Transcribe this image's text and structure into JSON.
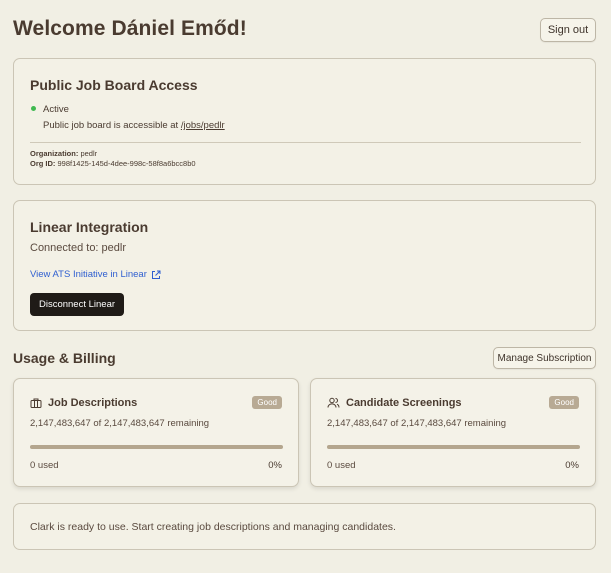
{
  "header": {
    "welcome": "Welcome Dániel Emőd!",
    "sign_out": "Sign out"
  },
  "public_board": {
    "title": "Public Job Board Access",
    "status": "Active",
    "description_prefix": "Public job board is accessible at ",
    "link": "/jobs/pedlr",
    "organization_label": "Organization:",
    "organization_value": "pedlr",
    "org_id_label": "Org ID:",
    "org_id_value": "998f1425-145d-4dee-998c-58f8a6bcc8b0"
  },
  "linear": {
    "title": "Linear Integration",
    "connected": "Connected to: pedlr",
    "link_label": "View ATS Initiative in Linear",
    "disconnect": "Disconnect Linear"
  },
  "billing": {
    "title": "Usage & Billing",
    "manage": "Manage Subscription",
    "job_descriptions": {
      "title": "Job Descriptions",
      "badge": "Good",
      "remaining": "2,147,483,647 of 2,147,483,647 remaining",
      "used": "0 used",
      "percent": "0%",
      "usage_fraction": 0
    },
    "candidate_screenings": {
      "title": "Candidate Screenings",
      "badge": "Good",
      "remaining": "2,147,483,647 of 2,147,483,647 remaining",
      "used": "0 used",
      "percent": "0%",
      "usage_fraction": 0
    }
  },
  "status_message": "Clark is ready to use. Start creating job descriptions and managing candidates.",
  "colors": {
    "background": "#f1efe4",
    "active_dot": "#3fb950",
    "link": "#2f5fd0",
    "dark_button": "#1f1b17",
    "badge": "#b8aa94"
  },
  "icons": {
    "external_link": "external-link-icon",
    "briefcase": "briefcase-icon",
    "users": "users-icon"
  }
}
